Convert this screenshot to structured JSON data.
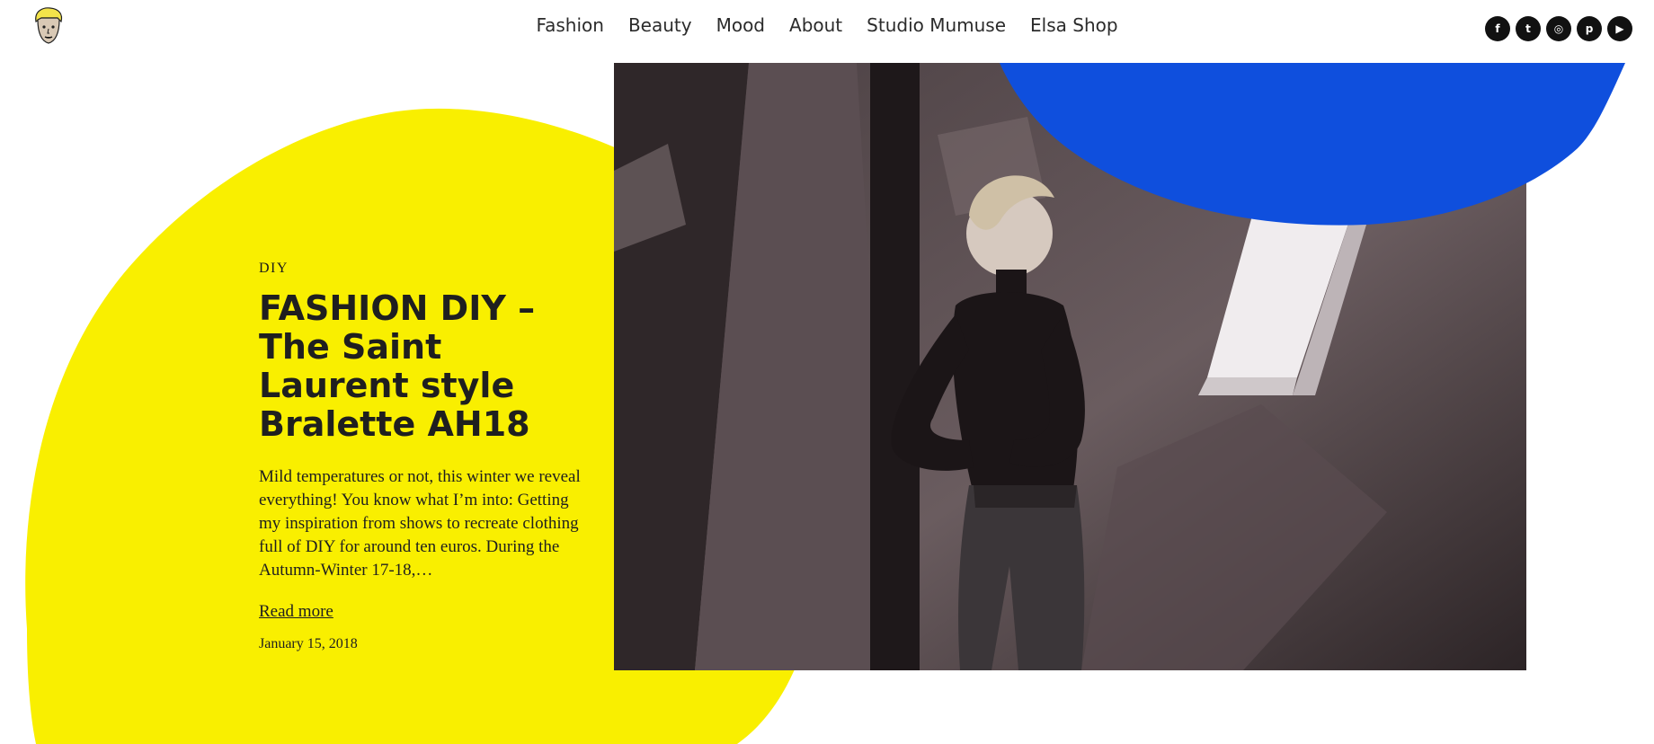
{
  "header": {
    "nav": [
      "Fashion",
      "Beauty",
      "Mood",
      "About",
      "Studio Mumuse",
      "Elsa Shop"
    ],
    "social": [
      {
        "icon": "facebook-icon",
        "glyph": "f"
      },
      {
        "icon": "twitter-icon",
        "glyph": "t"
      },
      {
        "icon": "instagram-icon",
        "glyph": "◎"
      },
      {
        "icon": "pinterest-icon",
        "glyph": "p"
      },
      {
        "icon": "youtube-icon",
        "glyph": "▶"
      }
    ]
  },
  "post": {
    "category": "DIY",
    "title": "FASHION DIY – The Saint Laurent style Bralette AH18",
    "excerpt": "Mild temperatures or not, this winter we reveal everything! You know what I’m into: Getting my inspiration from shows to recreate clothing full of DIY for around ten euros. During the Autumn-Winter 17-18,…",
    "read_more": "Read more",
    "date": "January 15, 2018"
  },
  "colors": {
    "yellow_blob": "#f9ef00",
    "blue_blob": "#0f4fdd",
    "icon_bg": "#111111"
  }
}
